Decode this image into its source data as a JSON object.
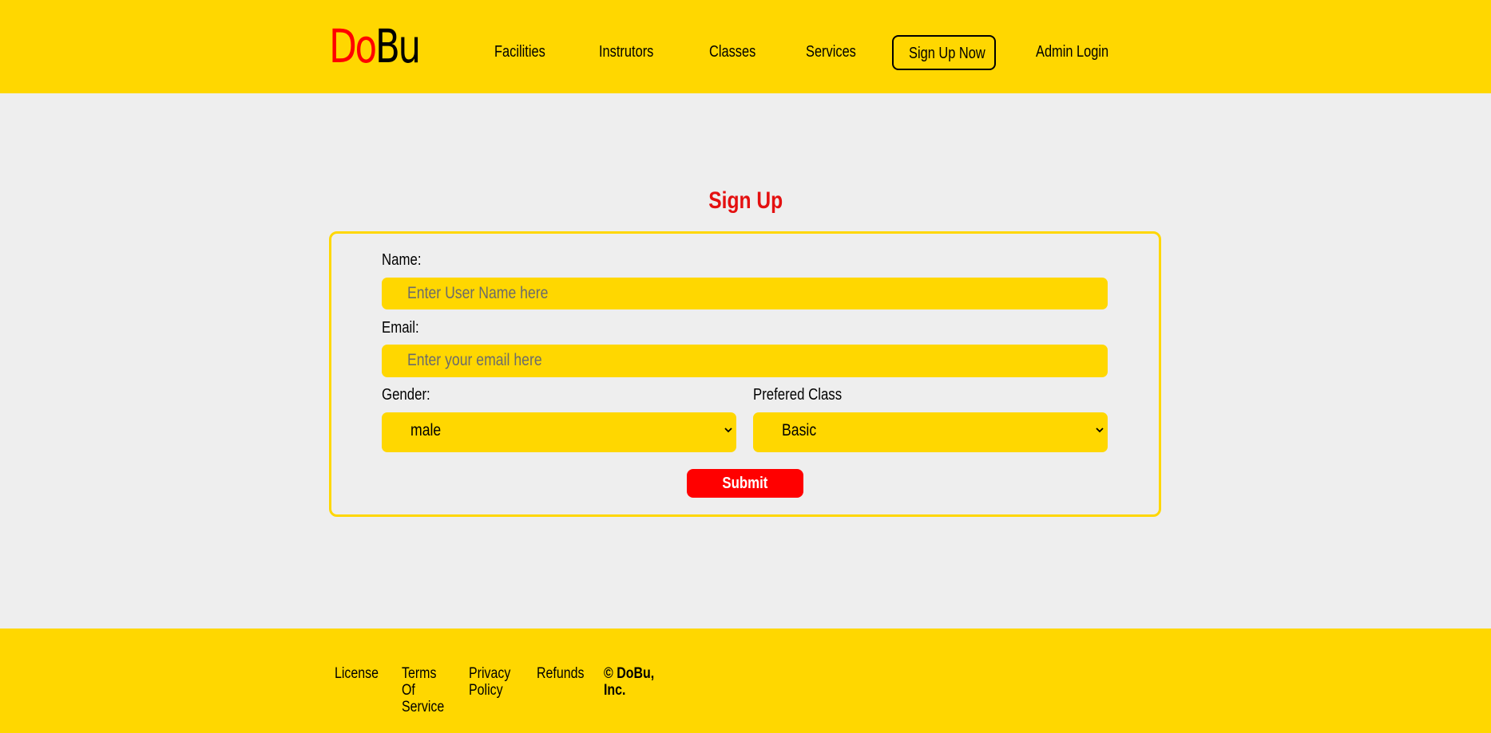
{
  "header": {
    "logo": {
      "part1": "Do",
      "part2": "Bu"
    },
    "nav": {
      "facilities": "Facilities",
      "instructors": "Instrutors",
      "classes": "Classes",
      "services": "Services",
      "signup": "Sign Up Now",
      "admin": "Admin Login"
    }
  },
  "form": {
    "title": "Sign Up",
    "name_label": "Name:",
    "name_placeholder": "Enter User Name here",
    "email_label": "Email:",
    "email_placeholder": "Enter your email here",
    "gender_label": "Gender:",
    "gender_value": "male",
    "class_label": "Prefered Class",
    "class_value": "Basic",
    "submit_label": "Submit"
  },
  "footer": {
    "license": "License",
    "terms": "Terms Of Service",
    "privacy": "Privacy Policy",
    "refunds": "Refunds",
    "copyright": "© DoBu, Inc."
  },
  "colors": {
    "brand_yellow": "#FFD700",
    "accent_red": "#FF0000",
    "background": "#EEEEEE"
  }
}
